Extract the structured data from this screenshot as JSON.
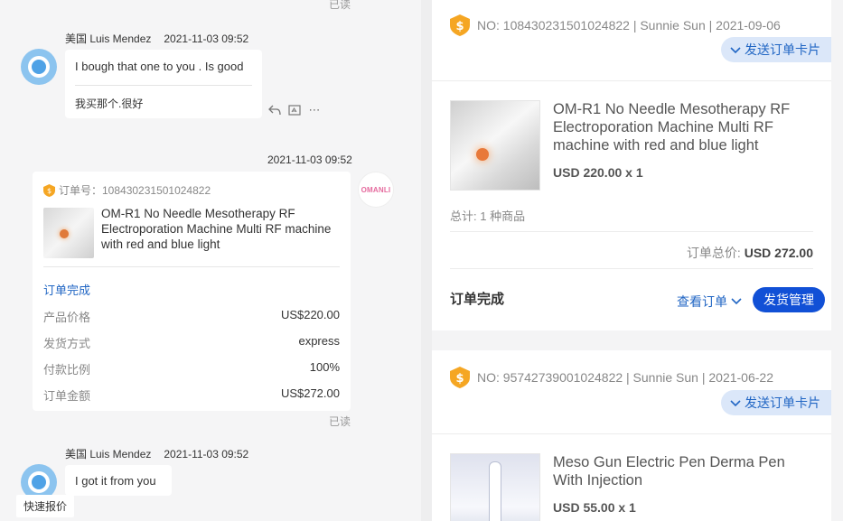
{
  "chat": {
    "read_top": "已读",
    "msg1": {
      "sender": "美国 Luis Mendez",
      "time": "2021-11-03 09:52",
      "text": "I bough that one to you . Is good",
      "translation": "我买那个.很好"
    },
    "msg2": {
      "time": "2021-11-03 09:52",
      "logo_text": "OMANLI",
      "order_label": "订单号：108430231501024822",
      "product_title": "OM-R1 No Needle Mesotherapy RF Electroporation Machine Multi RF machine with red and blue light",
      "status": "订单完成",
      "rows": [
        {
          "k": "产品价格",
          "v": "US$220.00"
        },
        {
          "k": "发货方式",
          "v": "express"
        },
        {
          "k": "付款比例",
          "v": "100%"
        },
        {
          "k": "订单金额",
          "v": "US$272.00"
        }
      ],
      "read": "已读"
    },
    "msg3": {
      "sender": "美国 Luis Mendez",
      "time": "2021-11-03 09:52",
      "text": "I got it from you"
    },
    "quick_quote": "快速报价"
  },
  "orders": [
    {
      "header": "NO: 108430231501024822 | Sunnie Sun | 2021-09-06",
      "send_card": "发送订单卡片",
      "title": "OM-R1 No Needle Mesotherapy RF Electroporation Machine Multi RF machine with red and blue light",
      "price": "USD 220.00 x 1",
      "summary": "总计: 1 种商品",
      "total_label": "订单总价:",
      "total_value": "USD 272.00",
      "status": "订单完成",
      "view_order": "查看订单",
      "ship_manage": "发货管理"
    },
    {
      "header": "NO: 95742739001024822 | Sunnie Sun | 2021-06-22",
      "send_card": "发送订单卡片",
      "title": "Meso Gun Electric Pen Derma Pen With Injection",
      "price": "USD 55.00 x 1"
    }
  ],
  "colors": {
    "accent": "#2166c4",
    "primary_button": "#1150d6",
    "badge": "#f5a623"
  }
}
